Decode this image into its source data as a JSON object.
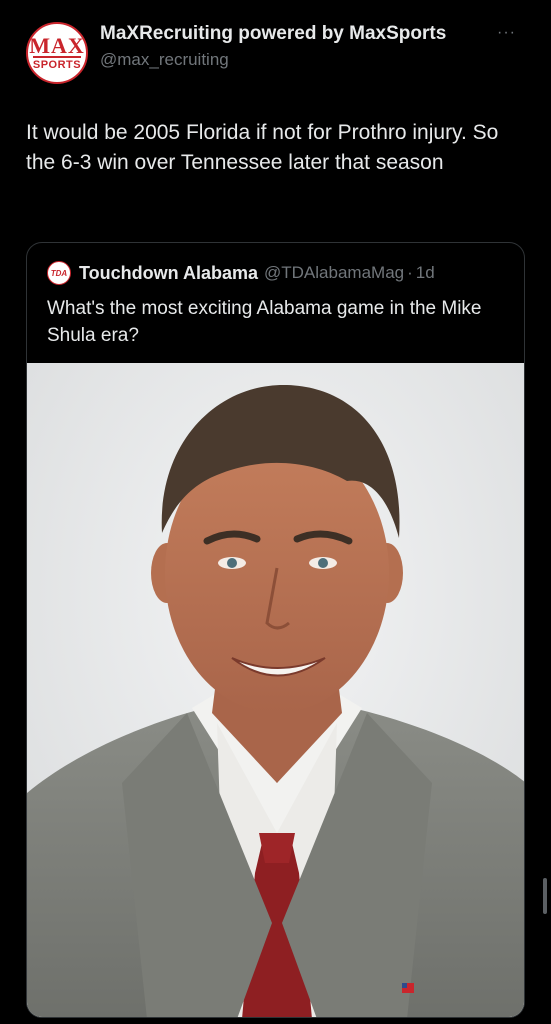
{
  "tweet": {
    "author": {
      "display_name": "MaXRecruiting powered by MaxSports",
      "handle": "@max_recruiting",
      "avatar_line1": "MAX",
      "avatar_line2": "SPORTS"
    },
    "more_icon": "more-horizontal-icon",
    "more_glyph": "···",
    "text": "It would be 2005 Florida if not for Prothro injury. So the 6-3 win over Tennessee later that season"
  },
  "quote": {
    "author": {
      "display_name": "Touchdown Alabama",
      "handle": "@TDAlabamaMag",
      "avatar_text": "TDA"
    },
    "separator": "·",
    "time": "1d",
    "text": "What's the most exciting Alabama game in the Mike Shula era?"
  },
  "colors": {
    "background": "#000000",
    "text_primary": "#e7e9ea",
    "text_secondary": "#71767b",
    "border": "#2f3336",
    "brand_red": "#c9252c"
  }
}
